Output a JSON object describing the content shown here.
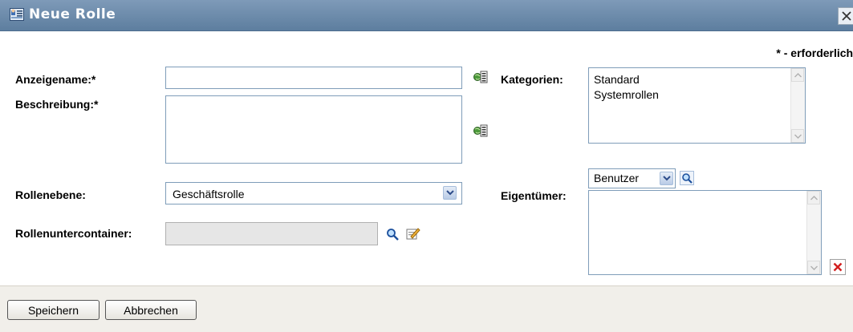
{
  "window": {
    "title": "Neue Rolle",
    "close_icon": "close-icon"
  },
  "required_note": "* - erforderlich.",
  "form": {
    "display_name": {
      "label": "Anzeigename:*",
      "value": ""
    },
    "description": {
      "label": "Beschreibung:*",
      "value": ""
    },
    "categories": {
      "label": "Kategorien:",
      "items": [
        "Standard",
        "Systemrollen"
      ]
    },
    "role_level": {
      "label": "Rollenebene:",
      "selected": "Geschäftsrolle"
    },
    "owners": {
      "label": "Eigentümer:",
      "type_selected": "Benutzer"
    },
    "role_subcontainer": {
      "label": "Rollenuntercontainer:",
      "value": ""
    }
  },
  "footer": {
    "save_label": "Speichern",
    "cancel_label": "Abbrechen"
  },
  "colors": {
    "title_bar": "#6b88a8",
    "footer_bg": "#f1efea",
    "field_border": "#7f9db9"
  }
}
